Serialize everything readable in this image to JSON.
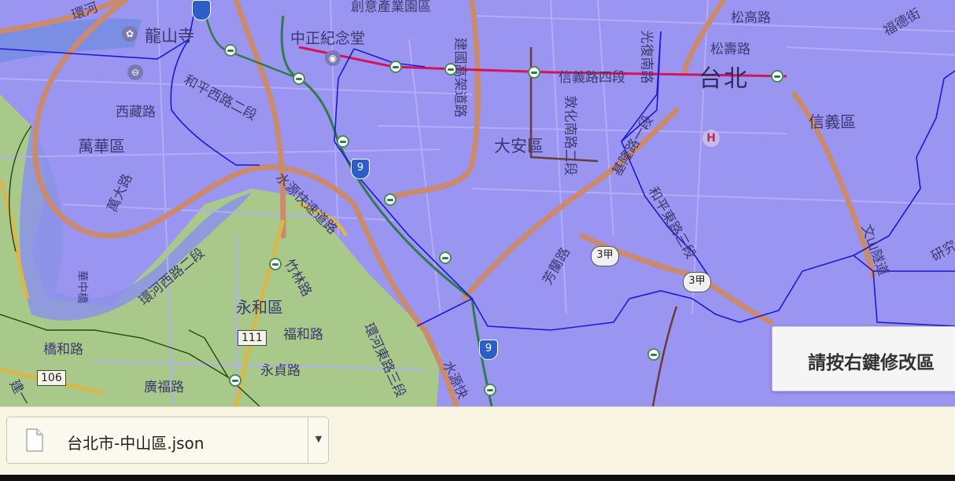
{
  "map": {
    "labels": {
      "longshan": "龍山寺",
      "zhongzheng": "中正紀念堂",
      "creative": "創意產業園區",
      "songgao": "松高路",
      "songshou": "松壽路",
      "fude": "福德街",
      "taipei": "台北",
      "xinyi_road": "信義路四段",
      "xinyi_district": "信義區",
      "jianguo": "建國高架道路",
      "dunhua": "敦化南路二段",
      "keelung": "基隆路一段",
      "guangfu": "光復南路",
      "xizang": "西藏路",
      "heping_w": "和平西路二段",
      "wanhua": "萬華區",
      "wanda": "萬大路",
      "daan": "大安區",
      "shuiyuan": "水源快速道路",
      "shuiyuan2": "水源快",
      "heping_e": "和平東路三段",
      "fangxing": "芳蘭路",
      "wenshan": "文山隧道",
      "research": "研究",
      "zhulin": "竹林路",
      "yonghe": "永和區",
      "fuhe": "福和路",
      "huanhe_w": "環河西路二段",
      "huanhe_e": "環河東路三段",
      "yongzhen": "永貞路",
      "qiaohe": "橋和路",
      "guangfu2": "廣福路",
      "huazhong": "華中橋",
      "jian": "建一",
      "huanhe_top": "環河"
    },
    "shields": {
      "r111": "111",
      "r106": "106",
      "r9a": "9",
      "r9b": "9",
      "r3a": "3甲",
      "r3b": "3甲",
      "hospital": "H"
    },
    "colors": {
      "overlay_blue": "#9b95f2",
      "overlay_green": "#a9c98a",
      "highway": "#c98a6e",
      "mrt_red": "#d4145a",
      "boundary": "#1a1ad6"
    }
  },
  "tooltip": {
    "text": "請按右鍵修改區"
  },
  "download_bar": {
    "file_name": "台北市-中山區.json",
    "menu_icon": "chevron-down-icon"
  }
}
